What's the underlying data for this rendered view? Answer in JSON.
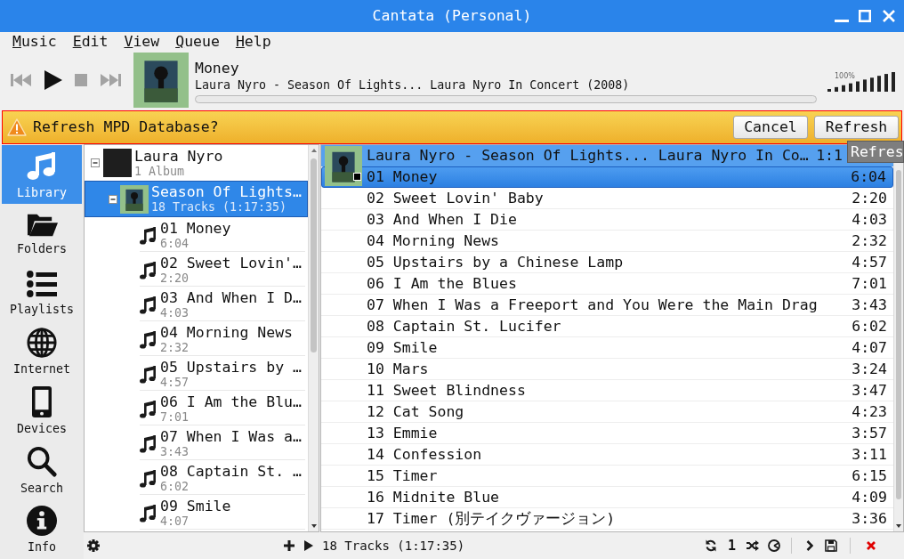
{
  "window": {
    "title": "Cantata (Personal)"
  },
  "menu": [
    "Music",
    "Edit",
    "View",
    "Queue",
    "Help"
  ],
  "player": {
    "controls": [
      {
        "kind": "previous",
        "disabled": true
      },
      {
        "kind": "play",
        "disabled": false
      },
      {
        "kind": "stop",
        "disabled": true
      },
      {
        "kind": "next",
        "disabled": true
      }
    ],
    "title": "Money",
    "subtitle": "Laura Nyro - Season Of Lights... Laura Nyro In Concert (2008)",
    "progress": {
      "level": 0
    },
    "volume": {
      "reading": "100%",
      "level": 1
    }
  },
  "notification": {
    "message": "Refresh MPD Database?",
    "buttons": [
      "Cancel",
      "Refresh"
    ],
    "tooltip": "Refres"
  },
  "sidebar": {
    "items": [
      {
        "label": "Library",
        "selected": true
      },
      {
        "label": "Folders",
        "selected": false
      },
      {
        "label": "Playlists",
        "selected": false
      },
      {
        "label": "Internet",
        "selected": false
      },
      {
        "label": "Devices",
        "selected": false
      },
      {
        "label": "Search",
        "selected": false
      },
      {
        "label": "Info",
        "selected": false
      }
    ]
  },
  "library_tree": [
    {
      "name": "Laura Nyro",
      "subtitle": "1 Album",
      "expanded": true,
      "selected": false,
      "children": [
        {
          "name": "Season Of Lights…",
          "subtitle": "18 Tracks (1:17:35)",
          "expanded": true,
          "selected": true,
          "children": [
            {
              "name": "01 Money",
              "duration": "6:04",
              "selected": false
            },
            {
              "name": "02 Sweet Lovin'…",
              "duration": "2:20",
              "selected": false
            },
            {
              "name": "03 And When I D…",
              "duration": "4:03",
              "selected": false
            },
            {
              "name": "04 Morning News",
              "duration": "2:32",
              "selected": false
            },
            {
              "name": "05 Upstairs by …",
              "duration": "4:57",
              "selected": false
            },
            {
              "name": "06 I Am the Blu…",
              "duration": "7:01",
              "selected": false
            },
            {
              "name": "07 When I Was a…",
              "duration": "3:43",
              "selected": false
            },
            {
              "name": "08 Captain St. …",
              "duration": "6:02",
              "selected": false
            },
            {
              "name": "09 Smile",
              "duration": "4:07",
              "selected": false
            }
          ]
        }
      ]
    }
  ],
  "queue": {
    "group": {
      "title": "Laura Nyro - Season Of Lights... Laura Nyro In Co…",
      "duration": "1:1"
    },
    "rows": [
      {
        "title": "01 Money",
        "duration": "6:04",
        "selected": true,
        "playing": true
      },
      {
        "title": "02 Sweet Lovin' Baby",
        "duration": "2:20",
        "selected": false,
        "playing": false
      },
      {
        "title": "03 And When I Die",
        "duration": "4:03",
        "selected": false,
        "playing": false
      },
      {
        "title": "04 Morning News",
        "duration": "2:32",
        "selected": false,
        "playing": false
      },
      {
        "title": "05 Upstairs by a Chinese Lamp",
        "duration": "4:57",
        "selected": false,
        "playing": false
      },
      {
        "title": "06 I Am the Blues",
        "duration": "7:01",
        "selected": false,
        "playing": false
      },
      {
        "title": "07 When I Was a Freeport and You Were the Main Drag",
        "duration": "3:43",
        "selected": false,
        "playing": false
      },
      {
        "title": "08 Captain St. Lucifer",
        "duration": "6:02",
        "selected": false,
        "playing": false
      },
      {
        "title": "09 Smile",
        "duration": "4:07",
        "selected": false,
        "playing": false
      },
      {
        "title": "10 Mars",
        "duration": "3:24",
        "selected": false,
        "playing": false
      },
      {
        "title": "11 Sweet Blindness",
        "duration": "3:47",
        "selected": false,
        "playing": false
      },
      {
        "title": "12 Cat Song",
        "duration": "4:23",
        "selected": false,
        "playing": false
      },
      {
        "title": "13 Emmie",
        "duration": "3:57",
        "selected": false,
        "playing": false
      },
      {
        "title": "14 Confession",
        "duration": "3:11",
        "selected": false,
        "playing": false
      },
      {
        "title": "15 Timer",
        "duration": "6:15",
        "selected": false,
        "playing": false
      },
      {
        "title": "16 Midnite Blue",
        "duration": "4:09",
        "selected": false,
        "playing": false
      },
      {
        "title": "17 Timer (別テイクヴァージョン)",
        "duration": "3:36",
        "selected": false,
        "playing": false
      }
    ]
  },
  "status_bar": {
    "summary": "18 Tracks (1:17:35)",
    "single_mode": "1"
  }
}
